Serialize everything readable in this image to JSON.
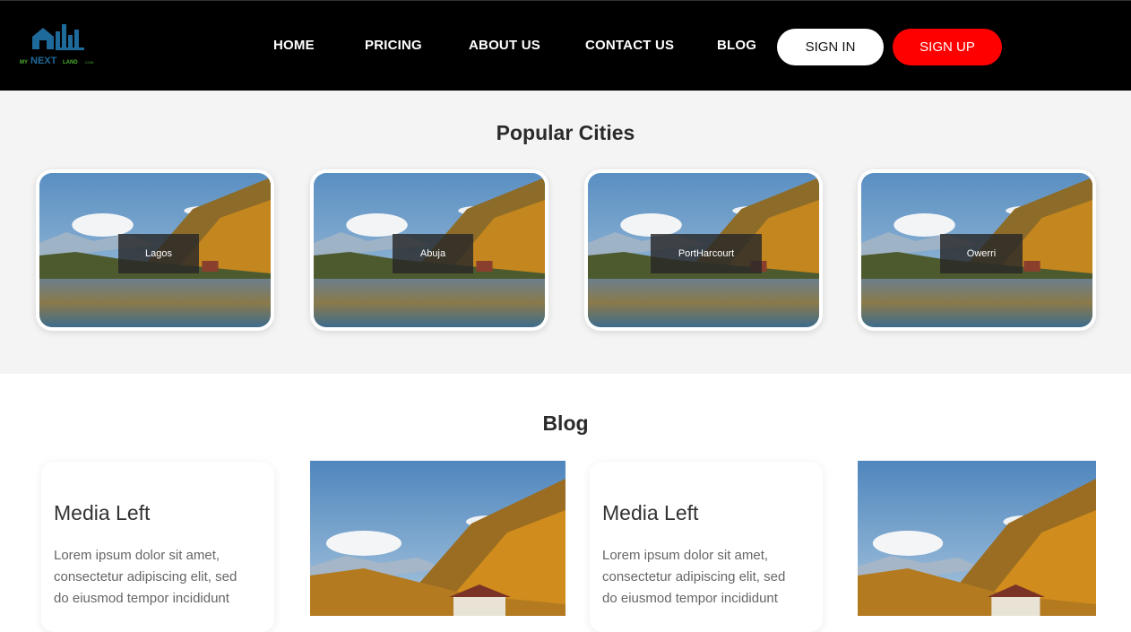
{
  "brand": {
    "logo_text_my": "MY",
    "logo_text_next": "NEXT",
    "logo_text_land": "LAND",
    "logo_text_com": ".COM",
    "colors": {
      "header_bg": "#000000",
      "signup": "#ff0000",
      "logo_blue": "#1e6a9a",
      "logo_green": "#4caf30"
    }
  },
  "nav": {
    "items": [
      "HOME",
      "PRICING",
      "ABOUT US",
      "CONTACT US",
      "BLOG"
    ],
    "signin_label": "SIGN IN",
    "signup_label": "SIGN UP"
  },
  "cities": {
    "title": "Popular Cities",
    "items": [
      {
        "name": "Lagos"
      },
      {
        "name": "Abuja"
      },
      {
        "name": "PortHarcourt"
      },
      {
        "name": "Owerri"
      }
    ]
  },
  "blog": {
    "title": "Blog",
    "posts": [
      {
        "title": "Media Left",
        "text": "Lorem ipsum dolor sit amet, consectetur adipiscing elit, sed do eiusmod tempor incididunt"
      },
      {
        "title": "Media Left",
        "text": "Lorem ipsum dolor sit amet, consectetur adipiscing elit, sed do eiusmod tempor incididunt"
      }
    ]
  }
}
